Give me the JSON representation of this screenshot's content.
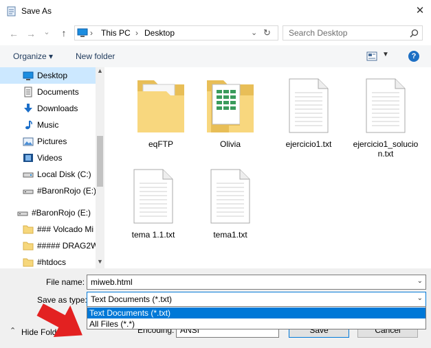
{
  "window": {
    "title": "Save As",
    "close": "✕"
  },
  "nav": {
    "back": "←",
    "forward": "→",
    "recent": "⌄",
    "up": "↑",
    "breadcrumb": [
      "This PC",
      "Desktop"
    ],
    "refresh": "↻",
    "search_placeholder": "Search Desktop"
  },
  "toolbar": {
    "organize": "Organize ▾",
    "new_folder": "New folder",
    "help": "?"
  },
  "sidebar": {
    "items": [
      {
        "label": "Desktop",
        "icon": "desktop-icon",
        "selected": true
      },
      {
        "label": "Documents",
        "icon": "documents-icon"
      },
      {
        "label": "Downloads",
        "icon": "downloads-icon"
      },
      {
        "label": "Music",
        "icon": "music-icon"
      },
      {
        "label": "Pictures",
        "icon": "pictures-icon"
      },
      {
        "label": "Videos",
        "icon": "videos-icon"
      },
      {
        "label": "Local Disk (C:)",
        "icon": "drive-icon"
      },
      {
        "label": "#BaronRojo (E:)",
        "icon": "usb-drive-icon"
      },
      {
        "label": "#BaronRojo (E:)",
        "icon": "usb-drive-icon"
      },
      {
        "label": "### Volcado Mi",
        "icon": "folder-icon"
      },
      {
        "label": "##### DRAG2W",
        "icon": "folder-icon"
      },
      {
        "label": "#htdocs",
        "icon": "folder-icon"
      }
    ]
  },
  "files": [
    {
      "name": "eqFTP",
      "type": "folder"
    },
    {
      "name": "Olivia",
      "type": "folder-sheets"
    },
    {
      "name": "ejercicio1.txt",
      "type": "text"
    },
    {
      "name": "ejercicio1_solucio",
      "name2": "n.txt",
      "type": "text"
    },
    {
      "name": "tema 1.1.txt",
      "type": "text"
    },
    {
      "name": "tema1.txt",
      "type": "text"
    }
  ],
  "form": {
    "file_name_label": "File name:",
    "file_name_value": "miweb.html",
    "save_type_label": "Save as type:",
    "save_type_value": "Text Documents (*.txt)",
    "options": [
      "Text Documents (*.txt)",
      "All Files  (*.*)"
    ],
    "hide_folders": "Hide Folders",
    "encoding_label": "Encoding:",
    "encoding_value": "ANSI",
    "save": "Save",
    "cancel": "Cancel"
  },
  "colors": {
    "accent": "#0078d7",
    "selection": "#cce8ff",
    "arrow": "#e32121"
  }
}
